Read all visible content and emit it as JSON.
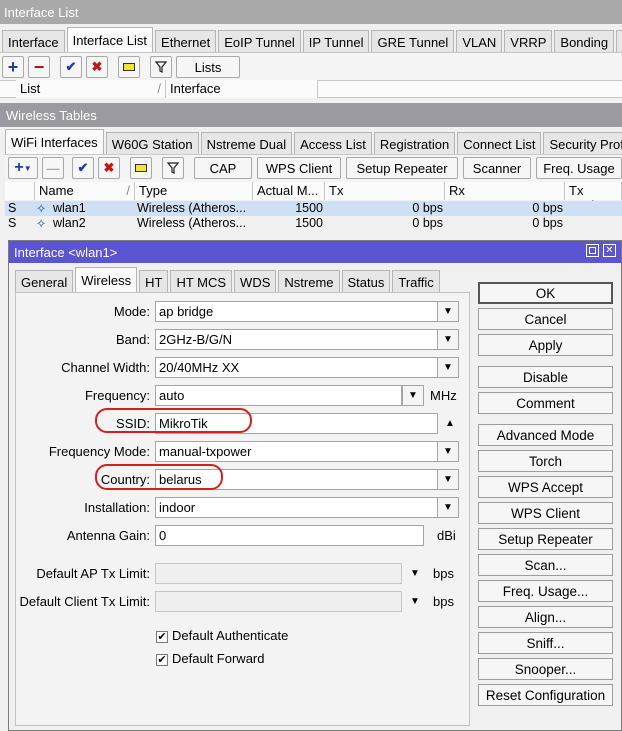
{
  "window": {
    "title": "Interface List"
  },
  "top_tabs": [
    "Interface",
    "Interface List",
    "Ethernet",
    "EoIP Tunnel",
    "IP Tunnel",
    "GRE Tunnel",
    "VLAN",
    "VRRP",
    "Bonding",
    "L"
  ],
  "top_toolbar": {
    "lists_label": "Lists"
  },
  "top_columns": [
    "List",
    "Interface"
  ],
  "wireless_window": {
    "title": "Wireless Tables"
  },
  "wireless_tabs": [
    "WiFi Interfaces",
    "W60G Station",
    "Nstreme Dual",
    "Access List",
    "Registration",
    "Connect List",
    "Security Prof"
  ],
  "wireless_toolbar": {
    "cap": "CAP",
    "wps_client": "WPS Client",
    "setup_repeater": "Setup Repeater",
    "scanner": "Scanner",
    "freq_usage": "Freq. Usage"
  },
  "wireless_columns": [
    "Name",
    "Type",
    "Actual M...",
    "Tx",
    "Rx",
    "Tx Packe"
  ],
  "wireless_rows": [
    {
      "flag": "S",
      "name": "wlan1",
      "type": "Wireless (Atheros...",
      "mtu": "1500",
      "tx": "0 bps",
      "rx": "0 bps"
    },
    {
      "flag": "S",
      "name": "wlan2",
      "type": "Wireless (Atheros...",
      "mtu": "1500",
      "tx": "0 bps",
      "rx": "0 bps"
    }
  ],
  "dialog": {
    "title": "Interface <wlan1>",
    "tabs": [
      "General",
      "Wireless",
      "HT",
      "HT MCS",
      "WDS",
      "Nstreme",
      "Status",
      "Traffic"
    ],
    "fields": {
      "mode": {
        "label": "Mode:",
        "value": "ap bridge"
      },
      "band": {
        "label": "Band:",
        "value": "2GHz-B/G/N"
      },
      "channel_width": {
        "label": "Channel Width:",
        "value": "20/40MHz XX"
      },
      "frequency": {
        "label": "Frequency:",
        "value": "auto",
        "unit": "MHz"
      },
      "ssid": {
        "label": "SSID:",
        "value": "MikroTik"
      },
      "frequency_mode": {
        "label": "Frequency Mode:",
        "value": "manual-txpower"
      },
      "country": {
        "label": "Country:",
        "value": "belarus"
      },
      "installation": {
        "label": "Installation:",
        "value": "indoor"
      },
      "antenna_gain": {
        "label": "Antenna Gain:",
        "value": "0",
        "unit": "dBi"
      },
      "default_ap_tx_limit": {
        "label": "Default AP Tx Limit:",
        "value": "",
        "unit": "bps"
      },
      "default_client_tx_limit": {
        "label": "Default Client Tx Limit:",
        "value": "",
        "unit": "bps"
      }
    },
    "checkboxes": {
      "default_authenticate": {
        "label": "Default Authenticate",
        "checked": true
      },
      "default_forward": {
        "label": "Default Forward",
        "checked": true
      }
    },
    "buttons": [
      "OK",
      "Cancel",
      "Apply",
      "Disable",
      "Comment",
      "Advanced Mode",
      "Torch",
      "WPS Accept",
      "WPS Client",
      "Setup Repeater",
      "Scan...",
      "Freq. Usage...",
      "Align...",
      "Sniff...",
      "Snooper...",
      "Reset Configuration"
    ]
  },
  "colors": {
    "dialog_title_bg": "#5b55d2",
    "highlight": "#d21f1f",
    "selected_row": "#cfe0f5"
  }
}
